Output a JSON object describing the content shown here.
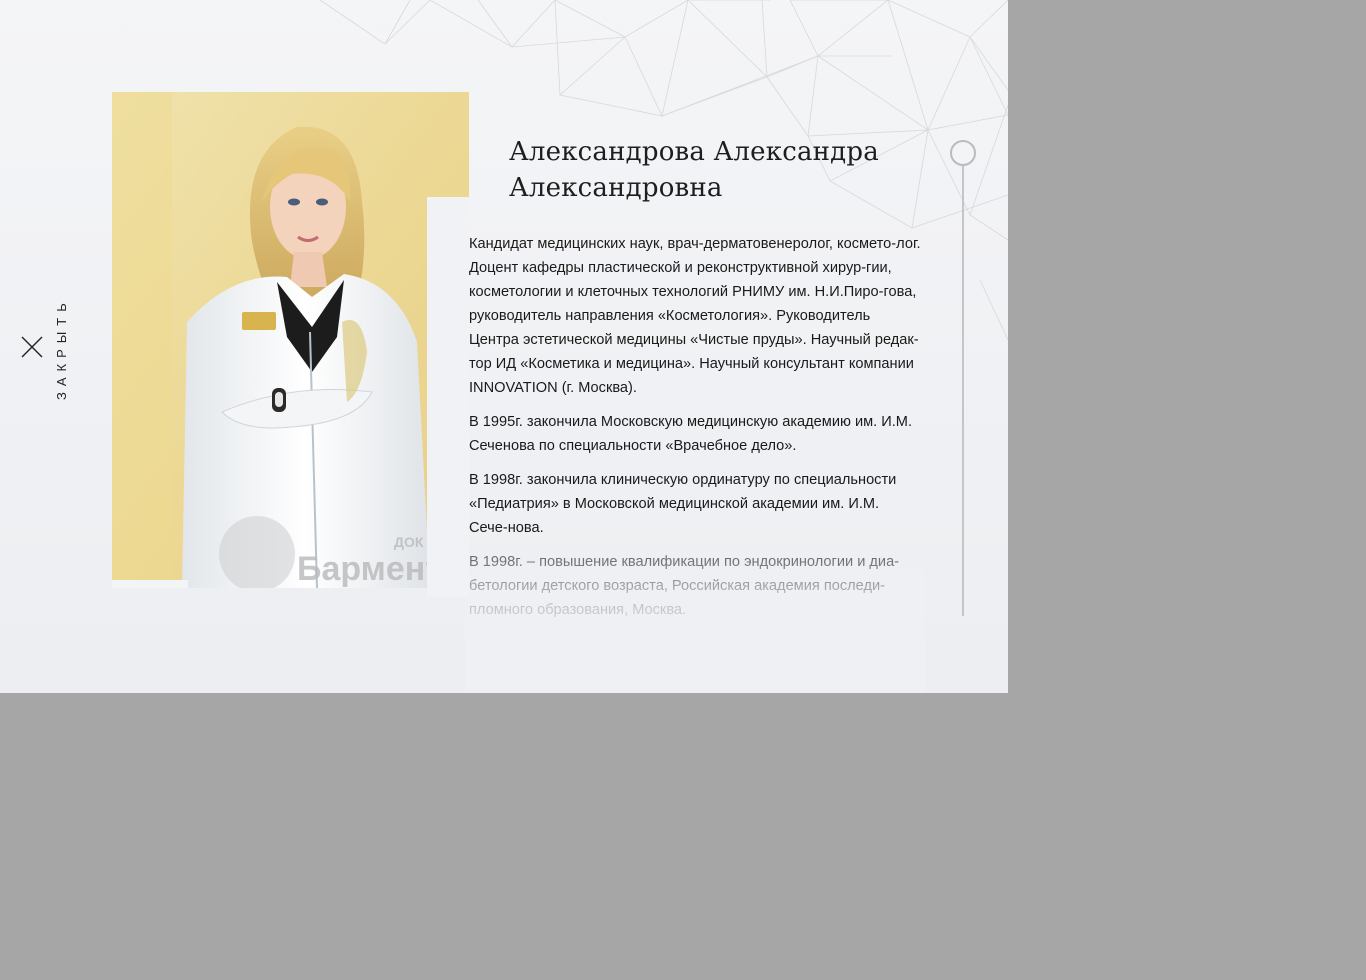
{
  "modal": {
    "close_label": "ЗАКРЫТЬ"
  },
  "doctor": {
    "name_line1": "Александрова Александра",
    "name_line2": "Александровна",
    "photo_watermark": "Бармента",
    "photo_watermark_small": "ДОК",
    "bio": [
      "Кандидат медицинских наук, врач-дерматовенеролог, космето-лог. Доцент кафедры пластической  и реконструктивной хирур-гии, косметологии и клеточных технологий РНИМУ им. Н.И.Пиро-гова, руководитель направления «Косметология». Руководитель Центра эстетической медицины «Чистые пруды». Научный редак-тор ИД «Косметика и медицина». Научный консультант компании INNOVATION (г. Москва).",
      "В 1995г. закончила Московскую медицинскую академию им. И.М. Сеченова по специальности «Врачебное дело».",
      "В 1998г. закончила клиническую ординатуру по специальности «Педиатрия» в Московской медицинской академии им. И.М. Сече-нова.",
      "В 1998г. – повышение квалификации по  эндокринологии и диа-бетологии детского возраста, Российская академия последи-пломного образования, Москва."
    ]
  },
  "colors": {
    "overlay": "#a6a6a6",
    "modal_bg": "#f1f2f5",
    "text": "#1a1a1a",
    "scroll": "#c3c5c9"
  },
  "icons": {
    "close": "close-icon",
    "scroll_thumb": "scroll-thumb-icon"
  }
}
